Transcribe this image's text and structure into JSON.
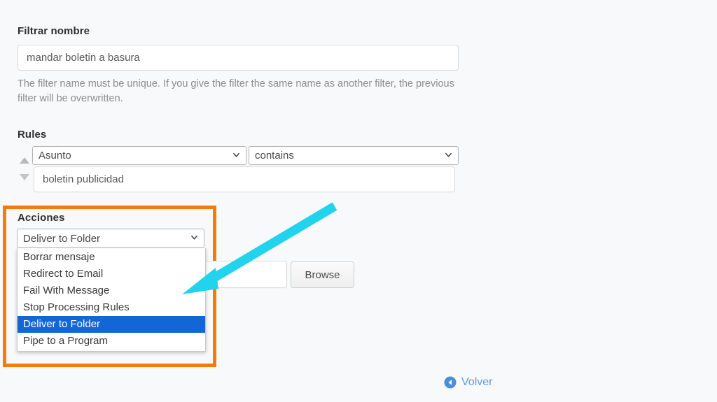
{
  "page": {
    "background_color": "#f8f9fa",
    "highlight_box_color": "#f57c0b",
    "annotation_arrow_color": "#22d3ee",
    "selected_option_color": "#1366d6",
    "link_color": "#5b9bd5"
  },
  "filter_name": {
    "label": "Filtrar nombre",
    "value": "mandar boletin a basura",
    "placeholder": "mandar boletin a basura",
    "help_text": "The filter name must be unique. If you give the filter the same name as another filter, the previous filter will be overwritten."
  },
  "rules": {
    "label": "Rules",
    "sort_up_icon": "triangle-up-icon",
    "sort_down_icon": "triangle-down-icon",
    "field_select": {
      "value": "Asunto",
      "chevron_icon": "chevron-down-icon"
    },
    "operator_select": {
      "value": "contains",
      "chevron_icon": "chevron-down-icon"
    },
    "value_input": {
      "value": "boletin publicidad",
      "placeholder": "boletin publicidad"
    }
  },
  "actions": {
    "label": "Acciones",
    "select": {
      "value": "Deliver to Folder",
      "chevron_icon": "chevron-down-icon",
      "expanded": true
    },
    "options": [
      {
        "label": "Borrar mensaje",
        "selected": false
      },
      {
        "label": "Redirect to Email",
        "selected": false
      },
      {
        "label": "Fail With Message",
        "selected": false
      },
      {
        "label": "Stop Processing Rules",
        "selected": false
      },
      {
        "label": "Deliver to Folder",
        "selected": true
      },
      {
        "label": "Pipe to a Program",
        "selected": false
      }
    ],
    "folder_input": {
      "value": "",
      "placeholder": ""
    },
    "browse_button": "Browse"
  },
  "footer": {
    "back_link": "Volver",
    "back_icon": "arrow-circle-left-icon"
  }
}
